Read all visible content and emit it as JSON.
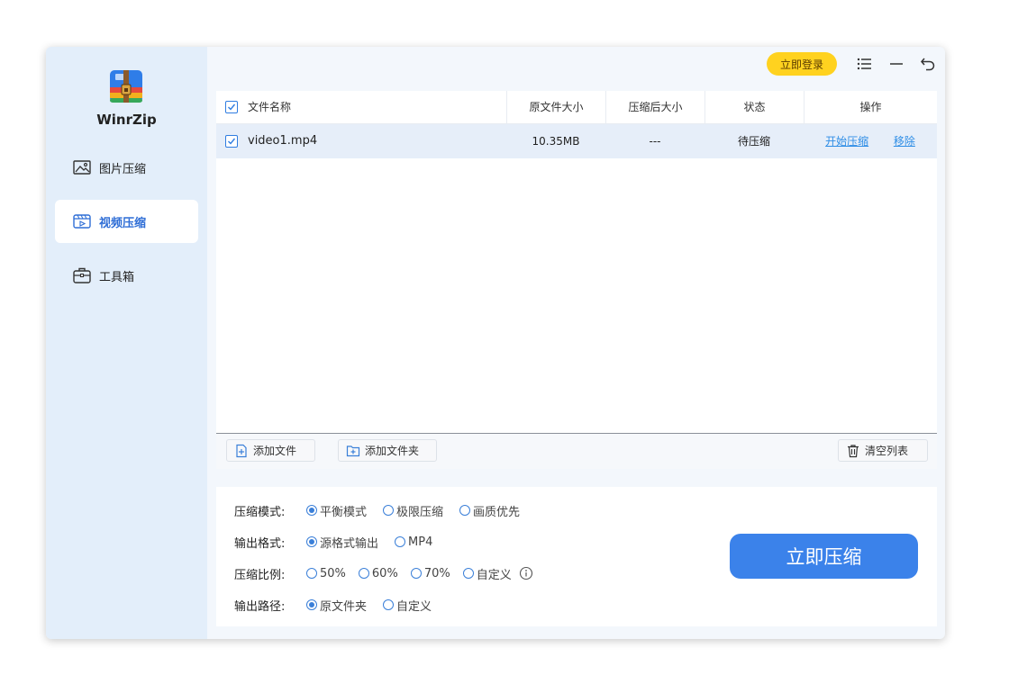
{
  "app": {
    "name": "WinrZip"
  },
  "sidebar": {
    "items": [
      {
        "label": "图片压缩",
        "icon": "image-icon",
        "active": false
      },
      {
        "label": "视频压缩",
        "icon": "video-icon",
        "active": true
      },
      {
        "label": "工具箱",
        "icon": "toolbox-icon",
        "active": false
      }
    ]
  },
  "header": {
    "login_label": "立即登录",
    "icons": [
      "menu-icon",
      "minimize-icon",
      "back-icon"
    ]
  },
  "table": {
    "columns": [
      "文件名称",
      "原文件大小",
      "压缩后大小",
      "状态",
      "操作"
    ],
    "rows": [
      {
        "checked": true,
        "name": "video1.mp4",
        "original_size": "10.35MB",
        "compressed_size": "---",
        "status": "待压缩",
        "actions": [
          "开始压缩",
          "移除"
        ]
      }
    ]
  },
  "footer": {
    "add_file": "添加文件",
    "add_folder": "添加文件夹",
    "clear_list": "清空列表"
  },
  "settings": {
    "mode": {
      "label": "压缩模式:",
      "options": [
        "平衡模式",
        "极限压缩",
        "画质优先"
      ],
      "selected": "平衡模式"
    },
    "format": {
      "label": "输出格式:",
      "options": [
        "源格式输出",
        "MP4"
      ],
      "selected": "源格式输出"
    },
    "ratio": {
      "label": "压缩比例:",
      "options": [
        "50%",
        "60%",
        "70%",
        "自定义"
      ],
      "selected": ""
    },
    "path": {
      "label": "输出路径:",
      "options": [
        "原文件夹",
        "自定义"
      ],
      "selected": "原文件夹"
    }
  },
  "compress_button": "立即压缩",
  "colors": {
    "accent": "#3b82ea",
    "login": "#ffd21f",
    "sidebar": "#e3eefa"
  }
}
